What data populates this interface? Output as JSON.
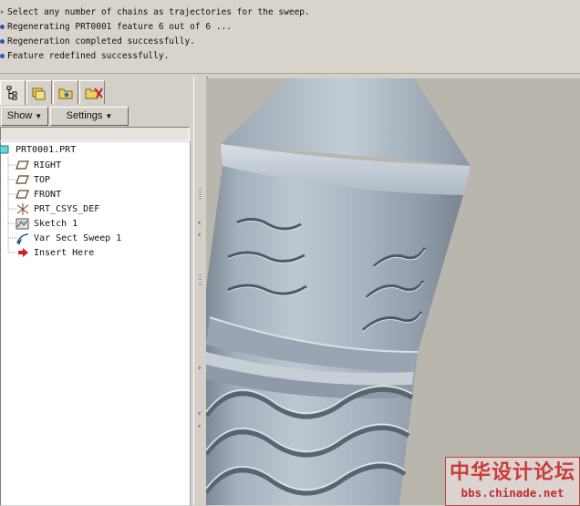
{
  "messages": [
    {
      "text": "Select any number of chains as trajectories for the sweep.",
      "type": "prompt"
    },
    {
      "text": "Regenerating PRT0001 feature 6 out of 6 ...",
      "type": "info"
    },
    {
      "text": "Regeneration completed successfully.",
      "type": "info"
    },
    {
      "text": "Feature redefined successfully.",
      "type": "info"
    }
  ],
  "panel": {
    "tabs": [
      "model-tree-icon",
      "layers-icon",
      "folder-icon",
      "favorites-icon"
    ],
    "show_label": "Show",
    "settings_label": "Settings"
  },
  "tree": {
    "root": "PRT0001.PRT",
    "items": [
      {
        "label": "RIGHT",
        "icon": "datum-plane-icon"
      },
      {
        "label": "TOP",
        "icon": "datum-plane-icon"
      },
      {
        "label": "FRONT",
        "icon": "datum-plane-icon"
      },
      {
        "label": "PRT_CSYS_DEF",
        "icon": "coordinate-system-icon"
      },
      {
        "label": "Sketch 1",
        "icon": "sketch-icon"
      },
      {
        "label": "Var Sect Sweep 1",
        "icon": "sweep-icon"
      },
      {
        "label": "Insert Here",
        "icon": "insert-arrow-icon"
      }
    ]
  },
  "watermark": {
    "chinese": "中华设计论坛",
    "url": "bbs.chinade.net"
  },
  "colors": {
    "window_bg": "#d4d0c8",
    "viewport_bg": "#b9b6ae",
    "model_surface": "#a9b4bf",
    "watermark": "#cc3a3a",
    "message_dot": "#2a56b8"
  }
}
